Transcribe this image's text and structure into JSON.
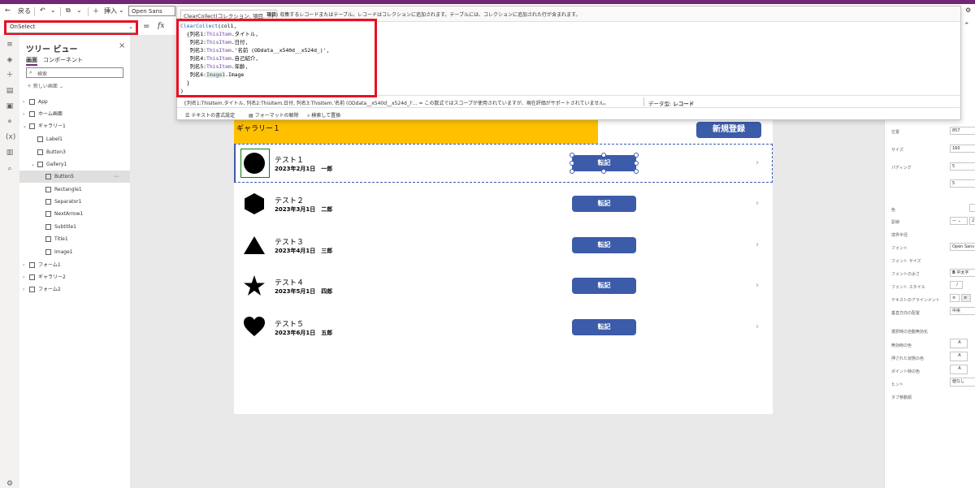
{
  "toolbar": {
    "back_label": "戻る",
    "insert_label": "挿入",
    "font_value": "Open Sans"
  },
  "formula": {
    "property_value": "OnSelect",
    "fx_label": "fx",
    "equals": "="
  },
  "tooltip": {
    "signature": "ClearCollect(コレクション, 項目, ...)",
    "hint_bold": "項目:",
    "hint_text": "収集するレコードまたはテーブル。レコードはコレクションに追加されます。テーブルには、コレクションに追加された行が含まれます。",
    "status_text": "{列名1:ThisItem.タイトル, 列名2:ThisItem.日付, 列名3:ThisItem.'名前 (ODdata__x540d__x524d_)'...  =  この数式ではスコープが使用されていますが、現在評価がサポートされていません。",
    "datatype_label": "データ型:",
    "datatype_value": "レコード",
    "format_text": "テキストの書式設定",
    "remove_format": "フォーマットの解除",
    "find_replace": "検索して置換"
  },
  "code_lines": [
    "ClearCollect(col1,",
    "  {列名1:ThisItem.タイトル,",
    "   列名2:ThisItem.日付,",
    "   列名3:ThisItem.'名前 (ODdata__x540d__x524d_)',",
    "   列名4:ThisItem.自己紹介,",
    "   列名5:ThisItem.年齢,",
    "   列名6:Image1.Image",
    "  }",
    ")"
  ],
  "tree": {
    "title": "ツリー ビュー",
    "tab_screens": "画面",
    "tab_components": "コンポーネント",
    "search_placeholder": "検索",
    "new_screen": "新しい画面",
    "items": [
      {
        "label": "App",
        "indent": 0
      },
      {
        "label": "ホーム画面",
        "indent": 0
      },
      {
        "label": "ギャラリー1",
        "indent": 0
      },
      {
        "label": "Label1",
        "indent": 1
      },
      {
        "label": "Button3",
        "indent": 1
      },
      {
        "label": "Gallery1",
        "indent": 1
      },
      {
        "label": "Button5",
        "indent": 2
      },
      {
        "label": "Rectangle1",
        "indent": 2
      },
      {
        "label": "Separator1",
        "indent": 2
      },
      {
        "label": "NextArrow1",
        "indent": 2
      },
      {
        "label": "Subtitle1",
        "indent": 2
      },
      {
        "label": "Title1",
        "indent": 2
      },
      {
        "label": "Image1",
        "indent": 2
      },
      {
        "label": "フォーム1",
        "indent": 0
      },
      {
        "label": "ギャラリー2",
        "indent": 0
      },
      {
        "label": "フォーム2",
        "indent": 0
      }
    ]
  },
  "app": {
    "header_title": "ギャラリー１",
    "new_button": "新規登録",
    "rows": [
      {
        "title": "テスト１",
        "subtitle": "2023年2月1日　一郎",
        "button": "転記",
        "shape": "circle"
      },
      {
        "title": "テスト２",
        "subtitle": "2023年3月1日　二郎",
        "button": "転記",
        "shape": "hexagon"
      },
      {
        "title": "テスト３",
        "subtitle": "2023年4月1日　三郎",
        "button": "転記",
        "shape": "triangle"
      },
      {
        "title": "テスト４",
        "subtitle": "2023年5月1日　四郎",
        "button": "転記",
        "shape": "star"
      },
      {
        "title": "テスト５",
        "subtitle": "2023年6月1日　五郎",
        "button": "転記",
        "shape": "heart"
      }
    ]
  },
  "props": {
    "position_label": "位置",
    "position_x": "857",
    "size_label": "サイズ",
    "size_w": "160",
    "padding_label": "パディング",
    "padding_v": "5",
    "padding_v2": "5",
    "color_label": "色",
    "border_label": "罫線",
    "border_value": "2",
    "corner_label": "境界半径",
    "font_label": "フォント",
    "font_value": "Open Sans",
    "fontsize_label": "フォント サイズ",
    "fontweight_label": "フォントの太さ",
    "fontweight_value": "中太字",
    "fontstyle_label": "フォント スタイル",
    "textalign_label": "テキストのアラインメント",
    "valign_label": "垂直方向の配置",
    "valign_value": "中央",
    "autodisable_label": "選択時の自動無効化",
    "disabled_color_label": "無効時の色",
    "pressed_color_label": "押された状態の色",
    "hover_color_label": "ポイント時の色",
    "tooltip_label": "ヒント",
    "tooltip_value": "値なし",
    "tabindex_label": "タブ移動順"
  }
}
